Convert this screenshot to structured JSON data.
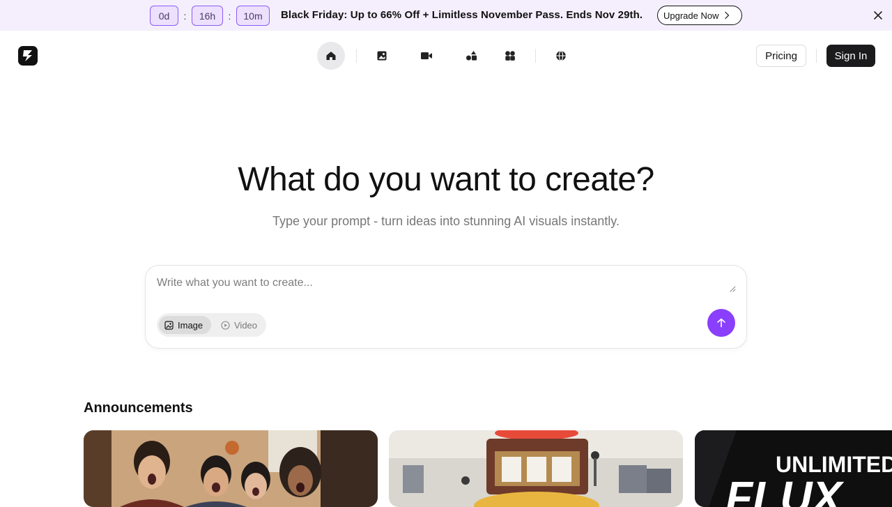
{
  "promo": {
    "countdown": [
      {
        "value": "0d"
      },
      {
        "value": "16h"
      },
      {
        "value": "10m"
      }
    ],
    "separator": ":",
    "text": "Black Friday: Up to 66% Off + Limitless November Pass. Ends Nov 29th.",
    "cta_label": "Upgrade Now"
  },
  "nav": {
    "icons": [
      "home-icon",
      "image-icon",
      "video-icon",
      "shapes-icon",
      "apps-icon",
      "globe-icon"
    ],
    "active": "home-icon",
    "pricing_label": "Pricing",
    "signin_label": "Sign In"
  },
  "hero": {
    "title": "What do you want to create?",
    "subtitle": "Type your prompt - turn ideas into stunning AI visuals instantly."
  },
  "prompt": {
    "placeholder": "Write what you want to create...",
    "modes": [
      {
        "label": "Image",
        "icon": "image-icon",
        "selected": true
      },
      {
        "label": "Video",
        "icon": "play-icon",
        "selected": false
      }
    ],
    "send_icon": "arrow-up-icon"
  },
  "announcements": {
    "title": "Announcements",
    "cards": [
      {
        "kind": "photo-people"
      },
      {
        "kind": "photo-slot-machine"
      },
      {
        "kind": "promo-graphic",
        "text_line1": "UNLIMITED",
        "text_line2": "FLUX"
      }
    ]
  },
  "colors": {
    "accent": "#8a3ffc",
    "banner_bg": "#f5effd",
    "countdown_border": "#8b5cf6",
    "signin_bg": "#1b1b1d"
  }
}
